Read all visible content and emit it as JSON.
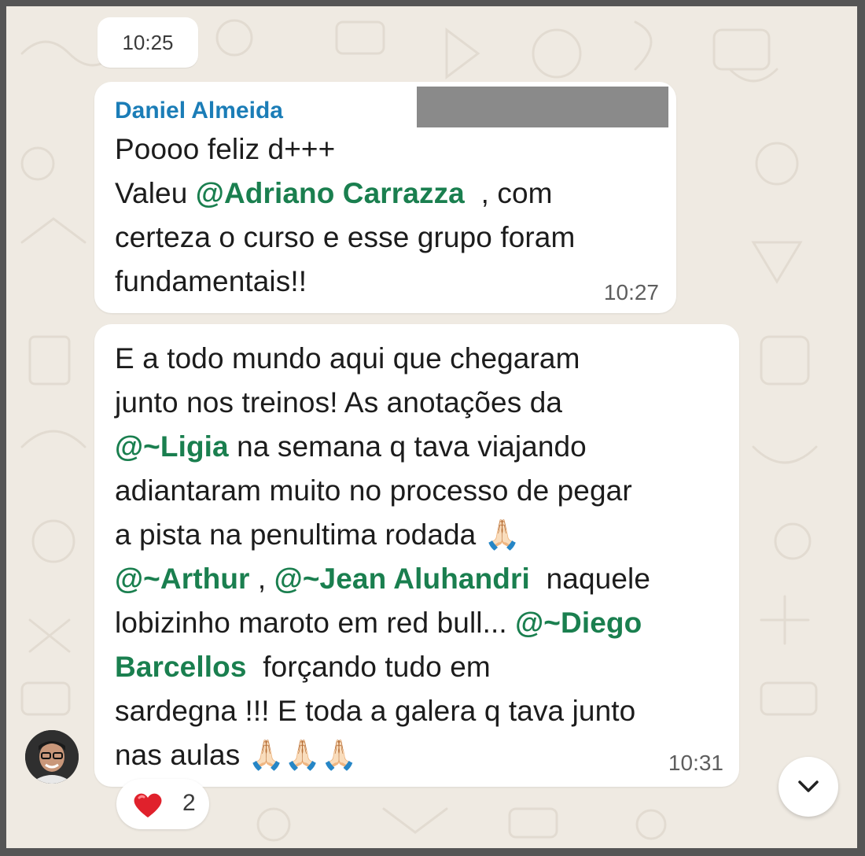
{
  "chat": {
    "date_chip_time": "10:25",
    "messages": [
      {
        "sender": "Daniel Almeida",
        "lines": [
          [
            "Poooo feliz d+++"
          ],
          [
            "Valeu ",
            {
              "m": "@Adriano Carrazza"
            },
            "  , com"
          ],
          [
            "certeza o curso e esse grupo foram"
          ],
          [
            "fundamentais!!"
          ]
        ],
        "time": "10:27"
      },
      {
        "lines": [
          [
            "E a todo mundo aqui que chegaram"
          ],
          [
            "junto nos treinos! As anotações da"
          ],
          [
            {
              "m": "@~Ligia"
            },
            " na semana q tava viajando"
          ],
          [
            "adiantaram muito no processo de pegar"
          ],
          [
            "a pista na penultima rodada 🙏🏻"
          ],
          [
            {
              "m": "@~Arthur"
            },
            " , ",
            {
              "m": "@~Jean Aluhandri"
            },
            "  naquele"
          ],
          [
            "lobizinho maroto em red bull... ",
            {
              "m": "@~Diego"
            }
          ],
          [
            {
              "m": "Barcellos"
            },
            "  forçando tudo em"
          ],
          [
            "sardegna !!! E toda a galera q tava junto"
          ],
          [
            "nas aulas 🙏🏻🙏🏻🙏🏻"
          ]
        ],
        "time": "10:31"
      }
    ],
    "reaction": {
      "icon": "heart-icon",
      "count": "2",
      "color": "#e0212c"
    },
    "scroll_button_icon": "chevron-down-icon"
  }
}
